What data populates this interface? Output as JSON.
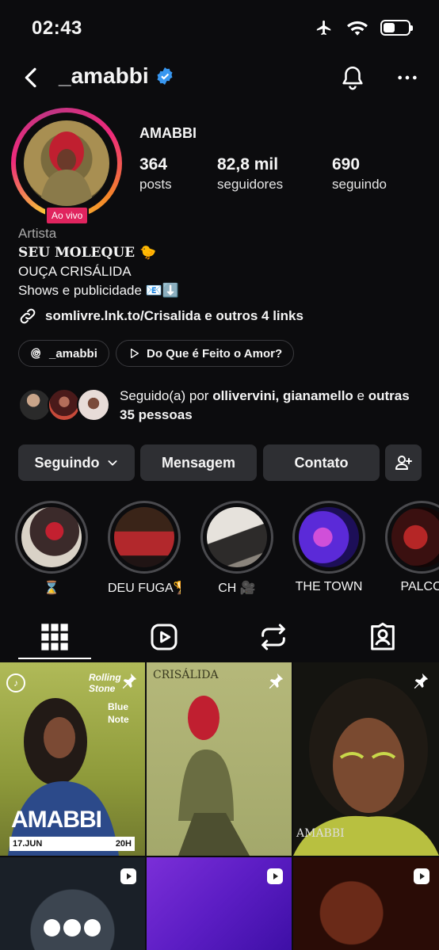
{
  "status": {
    "time": "02:43",
    "battery_level": 0.45
  },
  "header": {
    "username": "_amabbi",
    "verified_icon": "verified-badge-icon"
  },
  "profile": {
    "live_badge": "Ao vivo",
    "display_name": "AMABBI",
    "stats": [
      {
        "value": "364",
        "label": "posts"
      },
      {
        "value": "82,8 mil",
        "label": "seguidores"
      },
      {
        "value": "690",
        "label": "seguindo"
      }
    ],
    "category": "Artista",
    "bio_lines": [
      "SEU MOLEQUE 🐤",
      "OUÇA CRISÁLIDA",
      "Shows e publicidade 📧⬇️"
    ],
    "link": "somlivre.lnk.to/Crisalida e outros 4 links",
    "threads_pill": "_amabbi",
    "music_pill": "Do Que é Feito o Amor?",
    "followed_prefix": "Seguido(a) por ",
    "followed_names": "ollivervini, gianamello",
    "followed_mid": " e ",
    "followed_rest": "outras 35 pessoas"
  },
  "buttons": {
    "following": "Seguindo",
    "message": "Mensagem",
    "contact": "Contato"
  },
  "highlights": [
    {
      "label": "⌛"
    },
    {
      "label": "DEU FUGA🏆"
    },
    {
      "label": "CH 🎥"
    },
    {
      "label": "THE TOWN"
    },
    {
      "label": "PALCO"
    }
  ],
  "tabs": [
    "grid-icon",
    "reels-icon",
    "reposts-icon",
    "tagged-icon"
  ],
  "posts": [
    {
      "type": "pinned",
      "overlay_title": "AMABBI",
      "overlay_date": "17.JUN",
      "overlay_time": "20H",
      "overlay_brand": "Rolling Stone",
      "overlay_venue": "Blue Note"
    },
    {
      "type": "pinned",
      "overlay_title": "CRISÁLIDA"
    },
    {
      "type": "pinned",
      "overlay_title": "AMABBI"
    },
    {
      "type": "reel"
    },
    {
      "type": "reel"
    },
    {
      "type": "reel"
    }
  ]
}
